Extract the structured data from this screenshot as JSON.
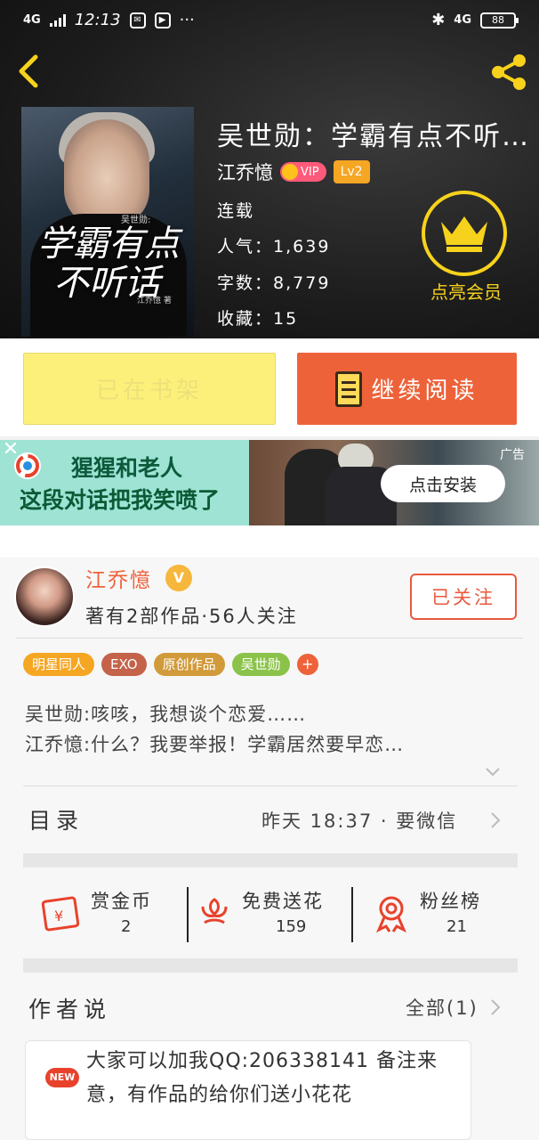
{
  "status_bar": {
    "network_left": "4G",
    "time": "12:13",
    "network_right": "4G",
    "battery": "88"
  },
  "book": {
    "title": "吴世勋：学霸有点不听…",
    "author": "江乔憶",
    "vip_label": "VIP",
    "level": "Lv2",
    "status": "连载",
    "popularity_label": "人气：",
    "popularity": "1,639",
    "words_label": "字数：",
    "words": "8,779",
    "favorites_label": "收藏：",
    "favorites": "15",
    "member_label": "点亮会员"
  },
  "cover": {
    "small_title": "吴世勋:",
    "title_line1": "学霸有点",
    "title_line2": "不听话",
    "author": "江乔憶 著"
  },
  "buttons": {
    "shelf": "已在书架",
    "read": "继续阅读"
  },
  "ad": {
    "line1": "猩猩和老人",
    "line2": "这段对话把我笑喷了",
    "install": "点击安装",
    "tag": "广告"
  },
  "author_card": {
    "name": "江乔憶",
    "verified": "V",
    "stats": "著有2部作品·56人关注",
    "follow": "已关注"
  },
  "tags": [
    {
      "label": "明星同人",
      "color": "#f5a623"
    },
    {
      "label": "EXO",
      "color": "#c4624a"
    },
    {
      "label": "原创作品",
      "color": "#d19a3a"
    },
    {
      "label": "吴世勋",
      "color": "#8bc34a"
    }
  ],
  "tag_add": "+",
  "description": {
    "line1": "吴世勋:咳咳，我想谈个恋爱……",
    "line2": "江乔憶:什么？我要举报！学霸居然要早恋…"
  },
  "catalog": {
    "label": "目录",
    "latest": "昨天 18:37 · 要微信"
  },
  "actions": [
    {
      "label": "赏金币",
      "value": "2"
    },
    {
      "label": "免费送花",
      "value": "159"
    },
    {
      "label": "粉丝榜",
      "value": "21"
    }
  ],
  "author_says": {
    "label": "作者说",
    "all": "全部(1)",
    "new_badge": "NEW",
    "text": "大家可以加我QQ:206338141 备注来意，有作品的给你们送小花花"
  },
  "colors": {
    "accent": "#ee623a",
    "gold": "#f7d21c",
    "shelf_yellow": "#fdf07a"
  }
}
